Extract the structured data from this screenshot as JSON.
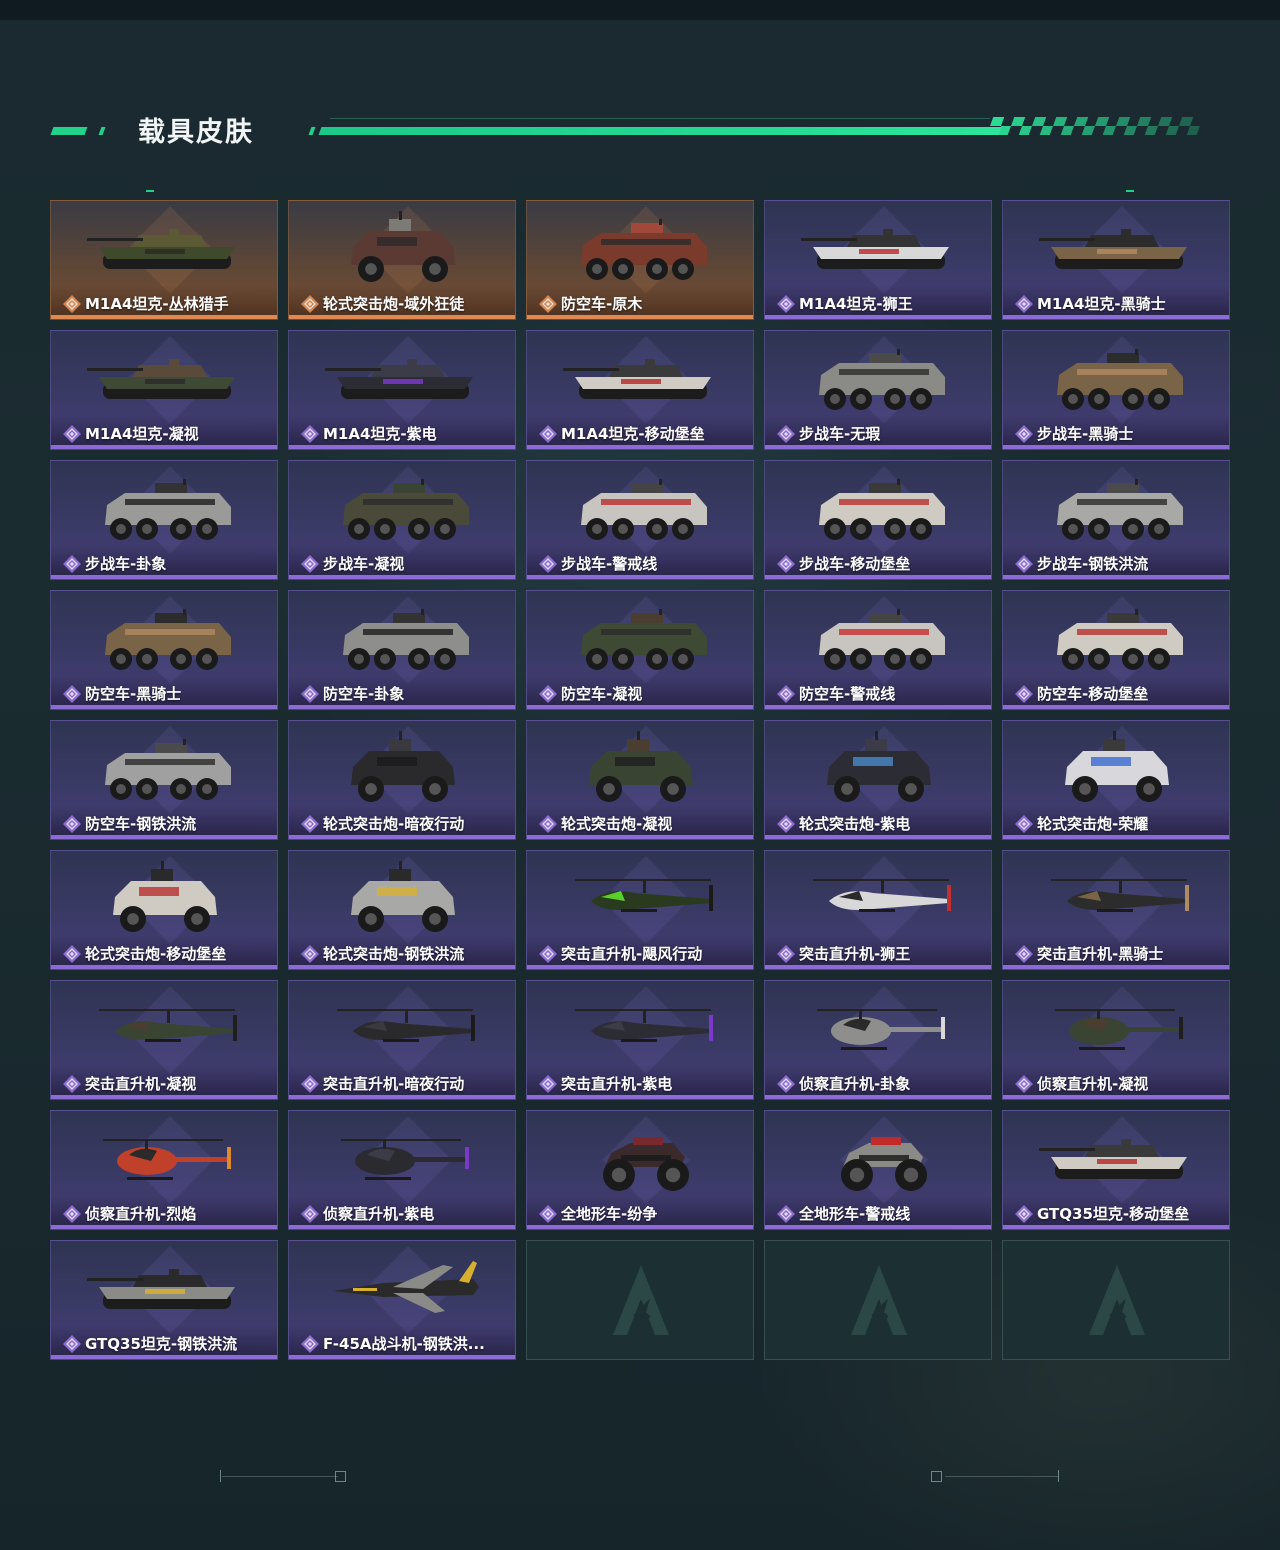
{
  "section": {
    "title": "载具皮肤"
  },
  "colors": {
    "accent": "#22d28a",
    "legendary_bar": "#e08850",
    "epic_bar": "#8d6bd6"
  },
  "skins": [
    {
      "name": "M1A4坦克-丛林猎手",
      "rarity": "legendary",
      "type": "tank",
      "palette": [
        "#3f4a2c",
        "#5b5a34",
        "#2c2c22"
      ]
    },
    {
      "name": "轮式突击炮-域外狂徒",
      "rarity": "legendary",
      "type": "armored-car",
      "palette": [
        "#5a3a32",
        "#7c7c76",
        "#2a2a2a"
      ]
    },
    {
      "name": "防空车-原木",
      "rarity": "legendary",
      "type": "apc",
      "palette": [
        "#7a3a2c",
        "#a0483a",
        "#2a2a2a"
      ]
    },
    {
      "name": "M1A4坦克-狮王",
      "rarity": "epic",
      "type": "tank",
      "palette": [
        "#d8d8d8",
        "#333333",
        "#c23030"
      ]
    },
    {
      "name": "M1A4坦克-黑骑士",
      "rarity": "epic",
      "type": "tank",
      "palette": [
        "#7a6448",
        "#2c2c2c",
        "#b08a60"
      ]
    },
    {
      "name": "M1A4坦克-凝视",
      "rarity": "epic",
      "type": "tank",
      "palette": [
        "#3e4a36",
        "#5a4a3a",
        "#2c2c2c"
      ]
    },
    {
      "name": "M1A4坦克-紫电",
      "rarity": "epic",
      "type": "tank",
      "palette": [
        "#2c2c34",
        "#3c3c48",
        "#7a3ac8"
      ]
    },
    {
      "name": "M1A4坦克-移动堡垒",
      "rarity": "epic",
      "type": "tank",
      "palette": [
        "#d0ccc4",
        "#3a3a3a",
        "#b83030"
      ]
    },
    {
      "name": "步战车-无瑕",
      "rarity": "epic",
      "type": "apc",
      "palette": [
        "#8a8a86",
        "#4a4a48",
        "#2a2a2a"
      ]
    },
    {
      "name": "步战车-黑骑士",
      "rarity": "epic",
      "type": "apc",
      "palette": [
        "#7a6448",
        "#2c2c2c",
        "#b08a60"
      ]
    },
    {
      "name": "步战车-卦象",
      "rarity": "epic",
      "type": "apc",
      "palette": [
        "#9a9a98",
        "#333333",
        "#1e1e1e"
      ]
    },
    {
      "name": "步战车-凝视",
      "rarity": "epic",
      "type": "apc",
      "palette": [
        "#4a4a3a",
        "#3a4434",
        "#2a2a2a"
      ]
    },
    {
      "name": "步战车-警戒线",
      "rarity": "epic",
      "type": "apc",
      "palette": [
        "#c8c4c0",
        "#444444",
        "#b83030"
      ]
    },
    {
      "name": "步战车-移动堡垒",
      "rarity": "epic",
      "type": "apc",
      "palette": [
        "#cfcac2",
        "#3a3a3a",
        "#b83030"
      ]
    },
    {
      "name": "步战车-钢铁洪流",
      "rarity": "epic",
      "type": "apc",
      "palette": [
        "#a8a8a6",
        "#4a4a4a",
        "#2a2a2a"
      ]
    },
    {
      "name": "防空车-黑骑士",
      "rarity": "epic",
      "type": "apc",
      "palette": [
        "#7a6448",
        "#2c2c2c",
        "#b08a60"
      ]
    },
    {
      "name": "防空车-卦象",
      "rarity": "epic",
      "type": "apc",
      "palette": [
        "#8e8e8c",
        "#333333",
        "#1e1e1e"
      ]
    },
    {
      "name": "防空车-凝视",
      "rarity": "epic",
      "type": "apc",
      "palette": [
        "#3e4a34",
        "#4a3e30",
        "#2a2a2a"
      ]
    },
    {
      "name": "防空车-警戒线",
      "rarity": "epic",
      "type": "apc",
      "palette": [
        "#c8c4c0",
        "#444444",
        "#c83030"
      ]
    },
    {
      "name": "防空车-移动堡垒",
      "rarity": "epic",
      "type": "apc",
      "palette": [
        "#cfcac2",
        "#3a3a3a",
        "#b83030"
      ]
    },
    {
      "name": "防空车-钢铁洪流",
      "rarity": "epic",
      "type": "apc",
      "palette": [
        "#a0a0a0",
        "#4a4a4a",
        "#2a2a2a"
      ]
    },
    {
      "name": "轮式突击炮-暗夜行动",
      "rarity": "epic",
      "type": "armored-car",
      "palette": [
        "#2a2a2c",
        "#3a3a3e",
        "#1a1a1a"
      ]
    },
    {
      "name": "轮式突击炮-凝视",
      "rarity": "epic",
      "type": "armored-car",
      "palette": [
        "#3a4432",
        "#4a3e30",
        "#1e1e1e"
      ]
    },
    {
      "name": "轮式突击炮-紫电",
      "rarity": "epic",
      "type": "armored-car",
      "palette": [
        "#2c2c34",
        "#3c3c48",
        "#4a8ac8"
      ]
    },
    {
      "name": "轮式突击炮-荣耀",
      "rarity": "epic",
      "type": "armored-car",
      "palette": [
        "#d8d8dc",
        "#3a3a3a",
        "#3a6ad0"
      ]
    },
    {
      "name": "轮式突击炮-移动堡垒",
      "rarity": "epic",
      "type": "armored-car",
      "palette": [
        "#cfcac2",
        "#2a2a2a",
        "#b83030"
      ]
    },
    {
      "name": "轮式突击炮-钢铁洪流",
      "rarity": "epic",
      "type": "armored-car",
      "palette": [
        "#a8a8a6",
        "#2a2a2a",
        "#d8b030"
      ]
    },
    {
      "name": "突击直升机-飓风行动",
      "rarity": "epic",
      "type": "attack-heli",
      "palette": [
        "#2a3a1e",
        "#5ad02a",
        "#1a1a1a"
      ]
    },
    {
      "name": "突击直升机-狮王",
      "rarity": "epic",
      "type": "attack-heli",
      "palette": [
        "#d8d8d8",
        "#2a2a2a",
        "#c23030"
      ]
    },
    {
      "name": "突击直升机-黑骑士",
      "rarity": "epic",
      "type": "attack-heli",
      "palette": [
        "#2c2c2c",
        "#7a6448",
        "#b08a60"
      ]
    },
    {
      "name": "突击直升机-凝视",
      "rarity": "epic",
      "type": "attack-heli",
      "palette": [
        "#3a4432",
        "#4a3e30",
        "#1e1e1e"
      ]
    },
    {
      "name": "突击直升机-暗夜行动",
      "rarity": "epic",
      "type": "attack-heli",
      "palette": [
        "#2a2a2c",
        "#3a3a3e",
        "#1a1a1a"
      ]
    },
    {
      "name": "突击直升机-紫电",
      "rarity": "epic",
      "type": "attack-heli",
      "palette": [
        "#2c2c34",
        "#3c3c48",
        "#7a3ac8"
      ]
    },
    {
      "name": "侦察直升机-卦象",
      "rarity": "epic",
      "type": "scout-heli",
      "palette": [
        "#8e8e8c",
        "#2a2a2a",
        "#d8d8d8"
      ]
    },
    {
      "name": "侦察直升机-凝视",
      "rarity": "epic",
      "type": "scout-heli",
      "palette": [
        "#3a4432",
        "#4a3e30",
        "#1e1e1e"
      ]
    },
    {
      "name": "侦察直升机-烈焰",
      "rarity": "epic",
      "type": "scout-heli",
      "palette": [
        "#c0402a",
        "#2a2a2a",
        "#e08a30"
      ]
    },
    {
      "name": "侦察直升机-紫电",
      "rarity": "epic",
      "type": "scout-heli",
      "palette": [
        "#2a2a30",
        "#3c3c48",
        "#7a3ac8"
      ]
    },
    {
      "name": "全地形车-纷争",
      "rarity": "epic",
      "type": "atv",
      "palette": [
        "#3a2a2c",
        "#7a2a2e",
        "#1a1a1a"
      ]
    },
    {
      "name": "全地形车-警戒线",
      "rarity": "epic",
      "type": "atv",
      "palette": [
        "#8a8a86",
        "#c02a2a",
        "#1e1e1e"
      ]
    },
    {
      "name": "GTQ35坦克-移动堡垒",
      "rarity": "epic",
      "type": "tank",
      "palette": [
        "#cfcac2",
        "#3a3a3a",
        "#b83030"
      ]
    },
    {
      "name": "GTQ35坦克-钢铁洪流",
      "rarity": "epic",
      "type": "tank",
      "palette": [
        "#8a8a86",
        "#2a2a2a",
        "#d8b030"
      ]
    },
    {
      "name": "F-45A战斗机-钢铁洪...",
      "rarity": "epic",
      "type": "jet",
      "palette": [
        "#2a2a2a",
        "#8a8a86",
        "#d8b030"
      ]
    },
    {
      "name": "",
      "rarity": "empty",
      "type": "empty",
      "palette": []
    },
    {
      "name": "",
      "rarity": "empty",
      "type": "empty",
      "palette": []
    },
    {
      "name": "",
      "rarity": "empty",
      "type": "empty",
      "palette": []
    }
  ]
}
